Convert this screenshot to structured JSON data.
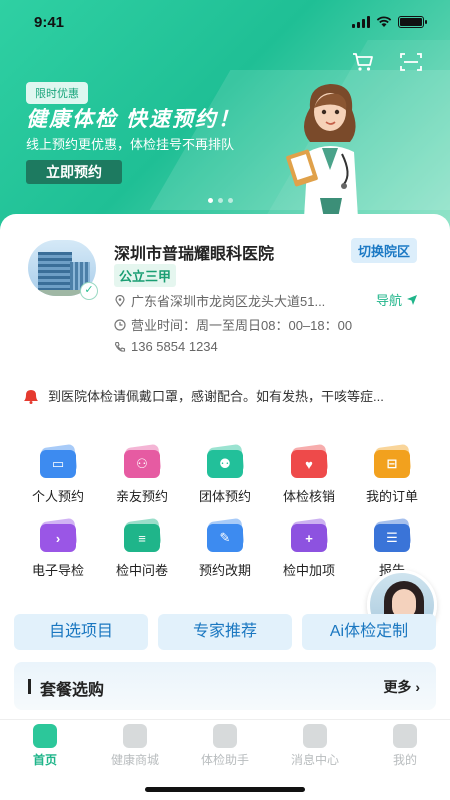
{
  "status_bar": {
    "time": "9:41"
  },
  "banner": {
    "badge": "限时优惠",
    "title": "健康体检 快速预约！",
    "subtitle": "线上预约更优惠，体检挂号不再排队",
    "button": "立即预约",
    "accent": "#1fbf95"
  },
  "hospital": {
    "name": "深圳市普瑞耀眼科医院",
    "switch_label": "切换院区",
    "level": "公立三甲",
    "address": "广东省深圳市龙岗区龙头大道51...",
    "nav_label": "导航",
    "hours": "营业时间：周一至周日08：00–18：00",
    "phone": "136 5854 1234"
  },
  "notice": {
    "text": "到医院体检请佩戴口罩，感谢配合。如有发热，干咳等症..."
  },
  "grid_items": [
    {
      "label": "个人预约",
      "icon": "id-card-icon",
      "color": "#3d8bf0"
    },
    {
      "label": "亲友预约",
      "icon": "friends-icon",
      "color": "#e65ba2"
    },
    {
      "label": "团体预约",
      "icon": "group-icon",
      "color": "#22c09a"
    },
    {
      "label": "体检核销",
      "icon": "heart-pulse-icon",
      "color": "#ee4a4a"
    },
    {
      "label": "我的订单",
      "icon": "cart-icon",
      "color": "#f2a11e"
    },
    {
      "label": "电子导检",
      "icon": "guide-icon",
      "color": "#9a56e6"
    },
    {
      "label": "检中问卷",
      "icon": "questionnaire-icon",
      "color": "#1fb58a"
    },
    {
      "label": "预约改期",
      "icon": "reschedule-icon",
      "color": "#3d8bf0"
    },
    {
      "label": "检中加项",
      "icon": "add-item-icon",
      "color": "#8d52e0"
    },
    {
      "label": "报告",
      "icon": "report-icon",
      "color": "#3a74d8"
    }
  ],
  "quick_buttons": [
    "自选项目",
    "专家推荐",
    "Ai体检定制"
  ],
  "package": {
    "title": "套餐选购",
    "more": "更多"
  },
  "tabs": [
    {
      "label": "首页",
      "icon": "home-icon"
    },
    {
      "label": "健康商城",
      "icon": "shop-icon"
    },
    {
      "label": "体检助手",
      "icon": "assistant-icon"
    },
    {
      "label": "消息中心",
      "icon": "message-icon"
    },
    {
      "label": "我的",
      "icon": "profile-icon"
    }
  ]
}
